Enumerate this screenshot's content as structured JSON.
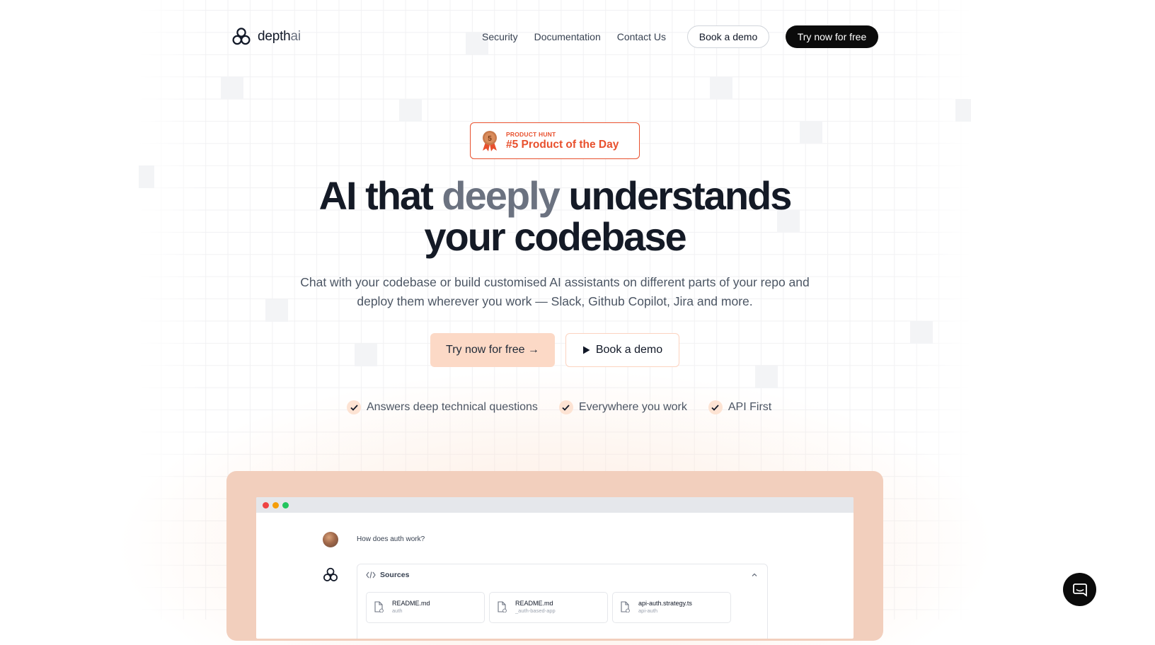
{
  "nav": {
    "logo_main": "depth",
    "logo_accent": "ai",
    "links": [
      "Security",
      "Documentation",
      "Contact Us"
    ],
    "book_demo": "Book a demo",
    "try_free": "Try now for free"
  },
  "badge": {
    "kicker": "PRODUCT HUNT",
    "title": "#5 Product of the Day",
    "rank": "5"
  },
  "hero": {
    "title_part1": "AI that ",
    "title_accent": "deeply",
    "title_part2": " understands",
    "title_line2": "your codebase",
    "subtitle": "Chat with your codebase or build customised AI assistants on different parts of your repo and deploy them wherever you work — Slack, Github Copilot, Jira and more.",
    "cta_primary": "Try now for free →",
    "cta_secondary": "Book a demo"
  },
  "features": [
    "Answers deep technical questions",
    "Everywhere you work",
    "API First"
  ],
  "demo": {
    "question": "How does auth work?",
    "sources_label": "Sources",
    "sources": [
      {
        "name": "README.md",
        "path": "auth"
      },
      {
        "name": "README.md",
        "path": "_auth-based-app"
      },
      {
        "name": "api-auth.strategy.ts",
        "path": "api-auth"
      }
    ]
  },
  "colors": {
    "accent": "#e8502d",
    "cta_bg": "#fcd9c6",
    "frame": "#f2cfbd",
    "dark": "#0b0b0b"
  },
  "icons": [
    "logo-hexagons-icon",
    "medal-icon",
    "play-icon",
    "check-icon",
    "code-icon",
    "chevron-up-icon",
    "file-icon",
    "github-icon",
    "chat-icon"
  ]
}
